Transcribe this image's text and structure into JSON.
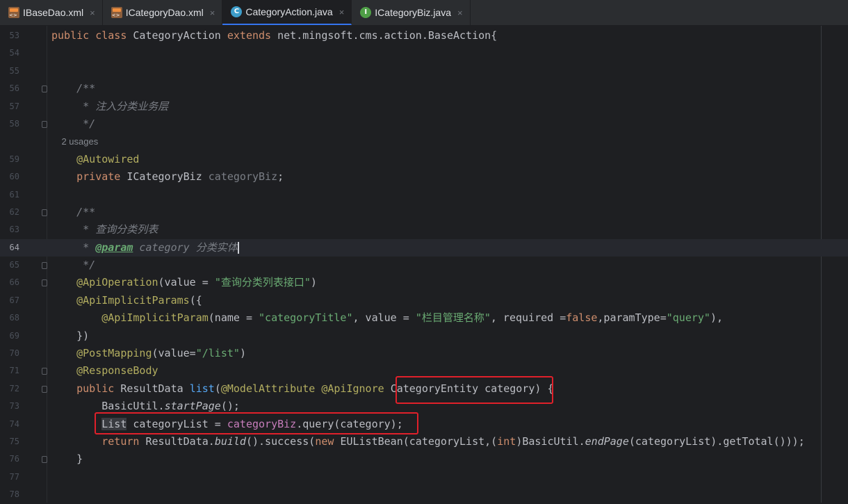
{
  "tabs": [
    {
      "label": "IBaseDao.xml",
      "icon": "xml-file-icon",
      "active": false
    },
    {
      "label": "ICategoryDao.xml",
      "icon": "xml-file-icon",
      "active": false
    },
    {
      "label": "CategoryAction.java",
      "icon": "java-class-icon",
      "active": true
    },
    {
      "label": "ICategoryBiz.java",
      "icon": "java-interface-icon",
      "active": false
    }
  ],
  "close_glyph": "×",
  "icon_glyphs": {
    "class": "C",
    "interface": "I"
  },
  "lines": [
    {
      "num": "53",
      "fold": false,
      "segments": [
        [
          "kw",
          "public class "
        ],
        [
          "",
          "CategoryAction "
        ],
        [
          "kw",
          "extends "
        ],
        [
          "",
          "net.mingsoft.cms.action.BaseAction{"
        ]
      ]
    },
    {
      "num": "54",
      "fold": false,
      "segments": []
    },
    {
      "num": "55",
      "fold": false,
      "segments": []
    },
    {
      "num": "56",
      "fold": true,
      "segments": [
        [
          "cm",
          "    /**"
        ]
      ]
    },
    {
      "num": "57",
      "fold": false,
      "segments": [
        [
          "cm",
          "     * 注入分类业务层"
        ]
      ]
    },
    {
      "num": "58",
      "fold": true,
      "segments": [
        [
          "cm",
          "     */"
        ]
      ]
    },
    {
      "num": "",
      "fold": false,
      "usages": "    2 usages",
      "segments": []
    },
    {
      "num": "59",
      "fold": false,
      "segments": [
        [
          "ann",
          "    @Autowired"
        ]
      ]
    },
    {
      "num": "60",
      "fold": false,
      "segments": [
        [
          "kw",
          "    private "
        ],
        [
          "",
          "ICategoryBiz "
        ],
        [
          "grey",
          "categoryBiz"
        ],
        [
          "",
          ";"
        ]
      ]
    },
    {
      "num": "61",
      "fold": false,
      "segments": []
    },
    {
      "num": "62",
      "fold": true,
      "segments": [
        [
          "cm",
          "    /**"
        ]
      ]
    },
    {
      "num": "63",
      "fold": false,
      "segments": [
        [
          "cm",
          "     * 查询分类列表"
        ]
      ]
    },
    {
      "num": "64",
      "fold": false,
      "caret": true,
      "segments": [
        [
          "cm",
          "     * "
        ],
        [
          "tag",
          "@param"
        ],
        [
          "param",
          " category "
        ],
        [
          "cm",
          "分类实体"
        ]
      ]
    },
    {
      "num": "65",
      "fold": true,
      "segments": [
        [
          "cm",
          "     */"
        ]
      ]
    },
    {
      "num": "66",
      "fold": true,
      "segments": [
        [
          "ann",
          "    @ApiOperation"
        ],
        [
          "",
          "(value = "
        ],
        [
          "str",
          "\"查询分类列表接口\""
        ],
        [
          "",
          ")"
        ]
      ]
    },
    {
      "num": "67",
      "fold": false,
      "segments": [
        [
          "ann",
          "    @ApiImplicitParams"
        ],
        [
          "",
          "({"
        ]
      ]
    },
    {
      "num": "68",
      "fold": false,
      "segments": [
        [
          "ann",
          "        @ApiImplicitParam"
        ],
        [
          "",
          "(name = "
        ],
        [
          "str",
          "\"categoryTitle\""
        ],
        [
          "",
          ", value = "
        ],
        [
          "str",
          "\"栏目管理名称\""
        ],
        [
          "",
          ", required ="
        ],
        [
          "kw",
          "false"
        ],
        [
          "",
          ",paramType="
        ],
        [
          "str",
          "\"query\""
        ],
        [
          "",
          "),"
        ]
      ]
    },
    {
      "num": "69",
      "fold": false,
      "segments": [
        [
          "",
          "    })"
        ]
      ]
    },
    {
      "num": "70",
      "fold": false,
      "segments": [
        [
          "ann",
          "    @PostMapping"
        ],
        [
          "",
          "(value="
        ],
        [
          "str",
          "\"/list\""
        ],
        [
          "",
          ")"
        ]
      ]
    },
    {
      "num": "71",
      "fold": true,
      "segments": [
        [
          "ann",
          "    @ResponseBody"
        ]
      ]
    },
    {
      "num": "72",
      "fold": true,
      "segments": [
        [
          "kw",
          "    public "
        ],
        [
          "",
          "ResultData "
        ],
        [
          "fn",
          "list"
        ],
        [
          "",
          "("
        ],
        [
          "ann",
          "@ModelAttribute @ApiIgnore "
        ],
        [
          "",
          "CategoryEntity category) {"
        ]
      ]
    },
    {
      "num": "73",
      "fold": false,
      "segments": [
        [
          "",
          "        BasicUtil."
        ],
        [
          "it",
          "startPage"
        ],
        [
          "",
          "();"
        ]
      ]
    },
    {
      "num": "74",
      "fold": false,
      "segments": [
        [
          "",
          "        "
        ],
        [
          "hl",
          "List"
        ],
        [
          "",
          " categoryList = "
        ],
        [
          "field",
          "categoryBiz"
        ],
        [
          "",
          ".query(category);"
        ]
      ]
    },
    {
      "num": "75",
      "fold": false,
      "segments": [
        [
          "kw",
          "        return "
        ],
        [
          "",
          "ResultData."
        ],
        [
          "it",
          "build"
        ],
        [
          "",
          "().success("
        ],
        [
          "kw",
          "new "
        ],
        [
          "",
          "EUListBean(categoryList,("
        ],
        [
          "kw",
          "int"
        ],
        [
          "",
          ")BasicUtil."
        ],
        [
          "it",
          "endPage"
        ],
        [
          "",
          "(categoryList).getTotal()));"
        ]
      ]
    },
    {
      "num": "76",
      "fold": true,
      "segments": [
        [
          "",
          "    }"
        ]
      ]
    },
    {
      "num": "77",
      "fold": false,
      "segments": []
    },
    {
      "num": "78",
      "fold": false,
      "segments": []
    }
  ]
}
